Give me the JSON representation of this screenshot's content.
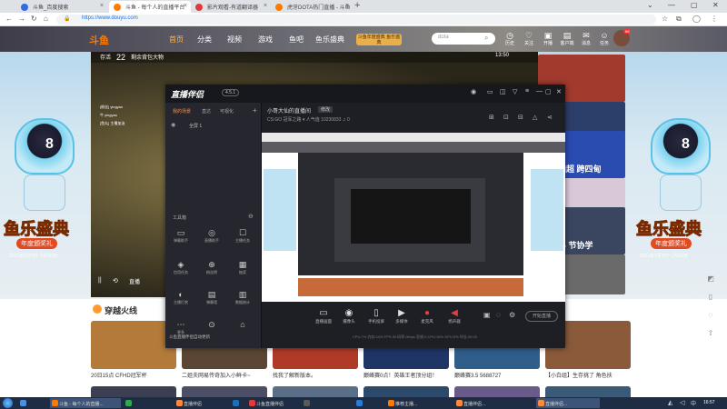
{
  "browser": {
    "tabs": [
      {
        "label": "斗鱼_百度搜索",
        "color": "#2f6de1"
      },
      {
        "label": "斗鱼 - 每个人的直播平台",
        "color": "#ff7a00"
      },
      {
        "label": "影片观看-有道翻译器",
        "color": "#e03b3b"
      },
      {
        "label": "虎牙DOTA热门直播 - 斗鱼",
        "color": "#ff7a00"
      }
    ],
    "url": "https://www.douyu.com",
    "new_tab": "+"
  },
  "site": {
    "logo": "斗鱼",
    "nav": [
      "首页",
      "分类",
      "视频",
      "游戏",
      "鱼吧",
      "鱼乐盛典"
    ],
    "promo": "斗鱼年度盛典 鱼乐盛典",
    "search_placeholder": "dota",
    "header_icons": [
      {
        "label": "历史",
        "glyph": "◷",
        "icon": "history-icon"
      },
      {
        "label": "关注",
        "glyph": "♡",
        "icon": "follow-icon"
      },
      {
        "label": "开播",
        "glyph": "▣",
        "icon": "broadcast-icon"
      },
      {
        "label": "客户端",
        "glyph": "▤",
        "icon": "client-icon"
      },
      {
        "label": "消息",
        "glyph": "✉",
        "icon": "message-icon"
      },
      {
        "label": "任务",
        "glyph": "☺",
        "icon": "task-icon"
      }
    ],
    "avatar_badge": "99"
  },
  "player": {
    "top_left": "存活",
    "top_num": "22",
    "top_mid": "剩余背包大物",
    "time": "13:50",
    "chat": [
      "[粉丝] yingyao",
      "牛 yingyao",
      "[鱼丸] 主播加油"
    ],
    "controls": [
      "||",
      "⟲",
      "24"
    ],
    "live_label": "直播"
  },
  "festival": {
    "title": "鱼乐盛典",
    "subtitle": "年度颁奖礼",
    "date": "2021年1月9日~1月10日",
    "mascot_number": "8"
  },
  "right_thumbs": [
    {
      "caption": "",
      "color": "#a23a2e"
    },
    {
      "caption": "",
      "color": "#2c3e6a"
    },
    {
      "caption": "跳舞四超 跨四甸",
      "color": "#2a4bb0"
    },
    {
      "caption": "",
      "color": "#d8c8d8"
    },
    {
      "caption": "新视界 节协学",
      "color": "#3a4560"
    },
    {
      "caption": "",
      "color": "#6a6a6a"
    }
  ],
  "app": {
    "logo": "直播伴侣",
    "version": "4.5.1",
    "left_tabs": [
      "我的场景",
      "直达",
      "可视化"
    ],
    "scene_row": "全屏 1",
    "tools_label": "工具箱",
    "tools": [
      {
        "label": "弹幕助手",
        "glyph": "▭",
        "icon": "danmaku-icon"
      },
      {
        "label": "直播助手",
        "glyph": "◎",
        "icon": "live-helper-icon"
      },
      {
        "label": "主播任务",
        "glyph": "☐",
        "icon": "task-icon"
      },
      {
        "label": "信用任务",
        "glyph": "◈",
        "icon": "credit-icon"
      },
      {
        "label": "粉丝榜",
        "glyph": "⊕",
        "icon": "fans-icon"
      },
      {
        "label": "抽奖",
        "glyph": "▦",
        "icon": "lottery-icon"
      },
      {
        "label": "主播打赏",
        "glyph": "◐",
        "icon": "reward-icon"
      },
      {
        "label": "弹幕墙",
        "glyph": "▤",
        "icon": "wall-icon"
      },
      {
        "label": "数据统计",
        "glyph": "▥",
        "icon": "stats-icon"
      },
      {
        "label": "更多",
        "glyph": "⋯",
        "icon": "more-icon"
      },
      {
        "label": "",
        "glyph": "⊙",
        "icon": "settings-icon"
      },
      {
        "label": "",
        "glyph": "⌂",
        "icon": "home-icon"
      }
    ],
    "room_name": "小哥大仙的直播间",
    "room_tag": "修改",
    "room_meta": "CS:GO 冠军之路 ▾   人气值 10230833  ♫ 0",
    "controls": [
      {
        "label": "直播画面",
        "glyph": "▭",
        "icon": "screen-icon"
      },
      {
        "label": "摄像头",
        "glyph": "◉",
        "icon": "camera-icon"
      },
      {
        "label": "手机投屏",
        "glyph": "▯",
        "icon": "phone-icon"
      },
      {
        "label": "多媒体",
        "glyph": "▶",
        "icon": "media-icon"
      },
      {
        "label": "麦克风",
        "glyph": "🎤",
        "icon": "mic-icon"
      },
      {
        "label": "扬声器",
        "glyph": "🔊",
        "icon": "speaker-icon"
      }
    ],
    "go_live": "开始直播",
    "status": "CPU:7%   内存:24%   FPS:30   码率:0kbps   丢帧:0   CPU:15%   GPU:5%   时长:00:00",
    "footer": "斗鱼直播伴侣自动更新"
  },
  "section": {
    "title": "穿越火线",
    "cards": [
      {
        "caption": "20日15点 CFHD冠军杯",
        "color": "#b37a3a"
      },
      {
        "caption": "二姐夫网易传奇加入小鲜卡~",
        "color": "#5a4632"
      },
      {
        "caption": "找我了解新版本。",
        "color": "#b03a28"
      },
      {
        "caption": "巅峰赛0点！英雄王者顶分组！",
        "color": "#1f3566"
      },
      {
        "caption": "巅峰赛3.5 5688727",
        "color": "#2f5e8a"
      },
      {
        "caption": "【小白组】生存挑了 角色扶",
        "color": "#8a5a3a"
      }
    ]
  },
  "taskbar": {
    "items": [
      {
        "label": "",
        "color": "#4a90e2"
      },
      {
        "label": "斗鱼 - 每个人的直播...",
        "color": "#ff7a00"
      },
      {
        "label": "",
        "color": "#2fa84f"
      },
      {
        "label": "直播伴侣",
        "color": "#ff8a3d"
      },
      {
        "label": "",
        "color": "#1d6fb8"
      },
      {
        "label": "斗鱼直播伴侣",
        "color": "#e03b3b"
      },
      {
        "label": "",
        "color": "#5a5a5a"
      },
      {
        "label": "",
        "color": "#2b7bd6"
      },
      {
        "label": "推荐主播...",
        "color": "#ff7a00"
      },
      {
        "label": "直播伴侣...",
        "color": "#ff8a3d"
      },
      {
        "label": "直播伴侣...",
        "color": "#ff8a3d"
      }
    ],
    "clock": "16:57"
  }
}
